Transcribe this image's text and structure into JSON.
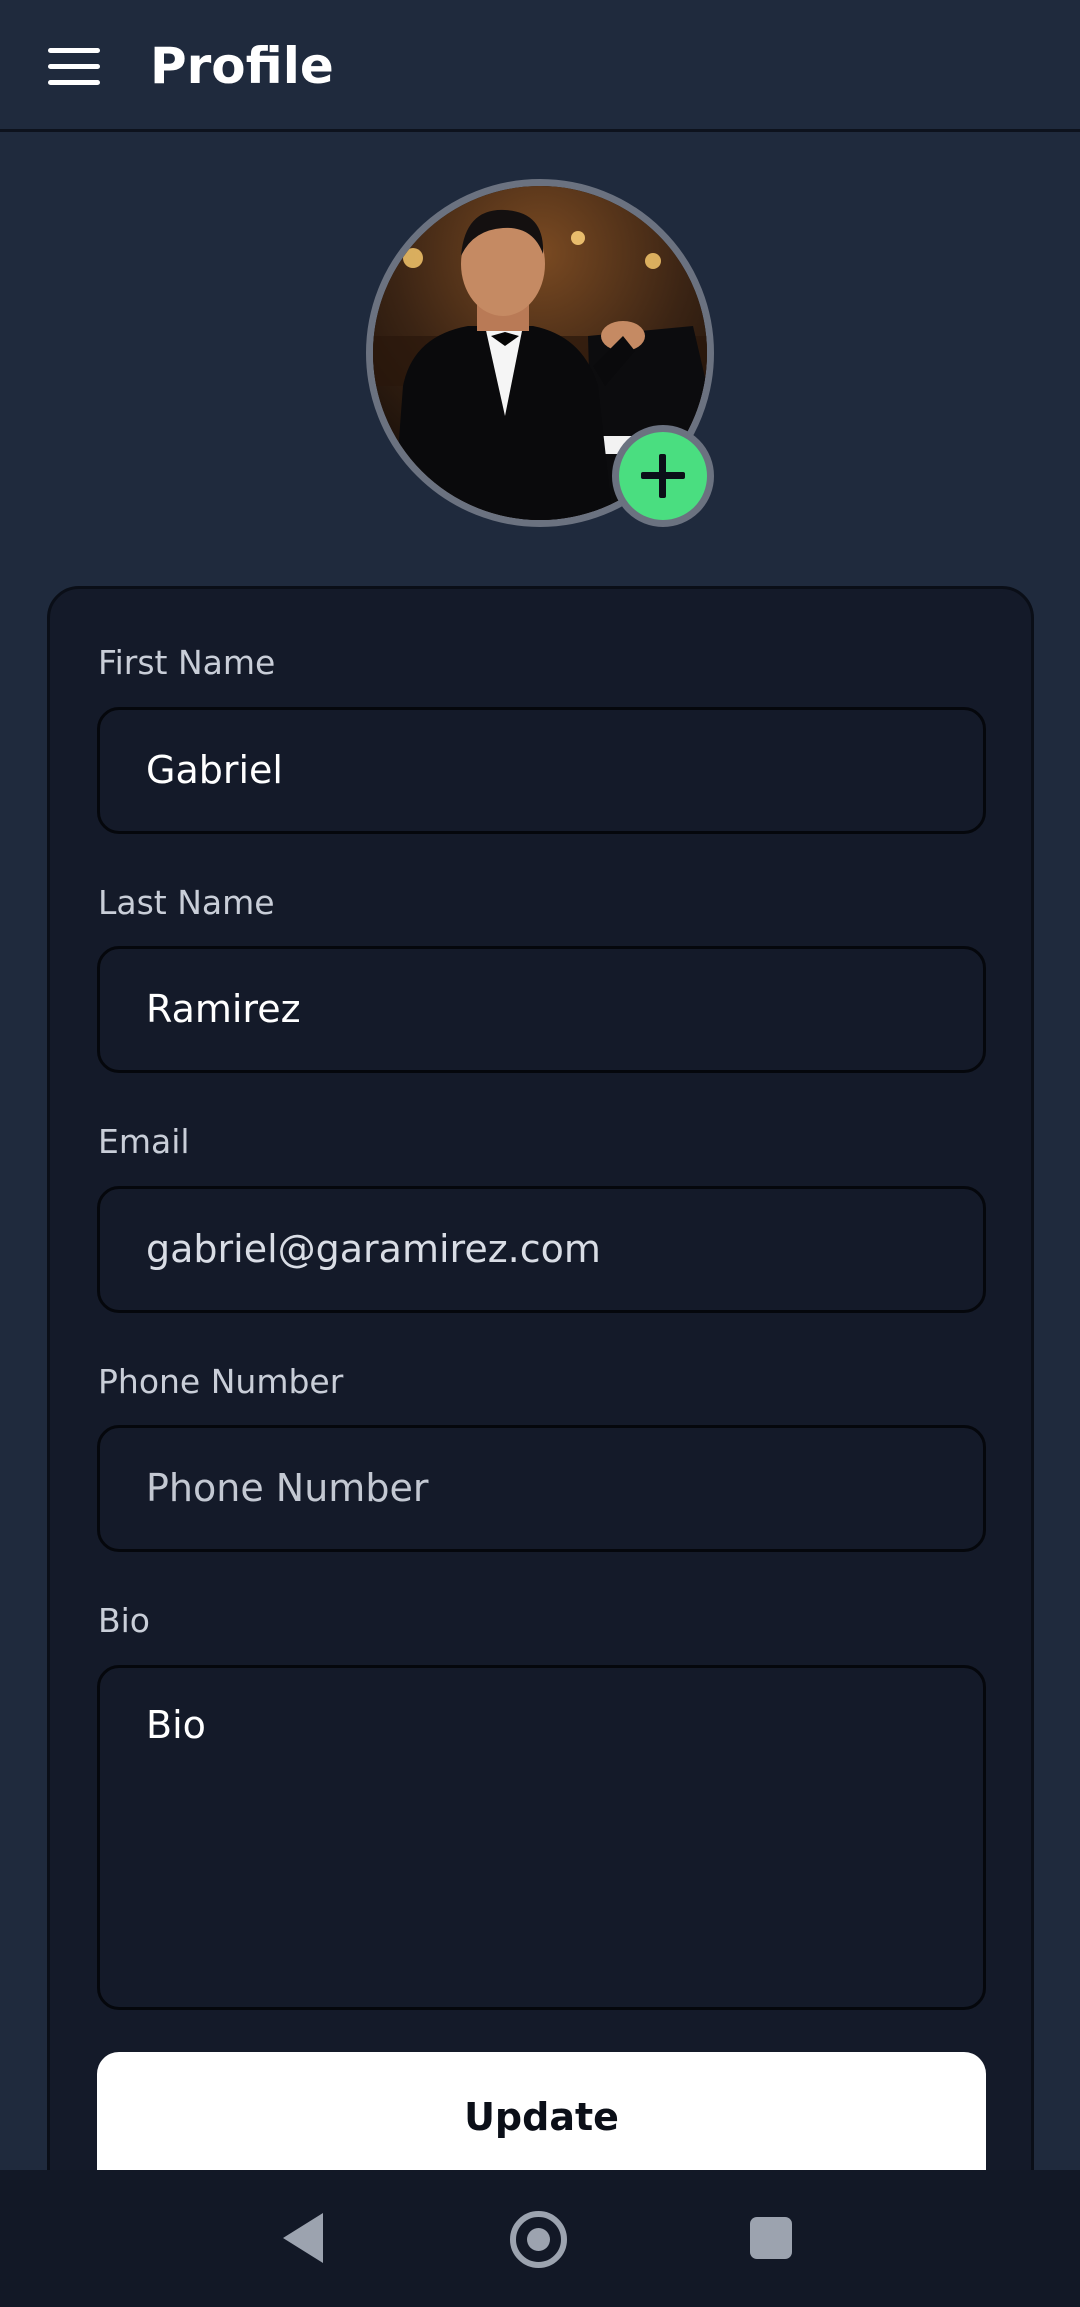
{
  "header": {
    "title": "Profile",
    "menu_icon": "hamburger-menu-icon"
  },
  "avatar": {
    "add_icon": "plus-icon",
    "accent_color": "#4ade80"
  },
  "form": {
    "first_name": {
      "label": "First Name",
      "value": "Gabriel"
    },
    "last_name": {
      "label": "Last Name",
      "value": "Ramirez"
    },
    "email": {
      "label": "Email",
      "value": "gabriel@garamirez.com"
    },
    "phone": {
      "label": "Phone Number",
      "value": "",
      "placeholder": "Phone Number"
    },
    "bio": {
      "label": "Bio",
      "value": "",
      "placeholder": "Bio"
    },
    "update_label": "Update"
  },
  "system_nav": {
    "back_icon": "back-triangle-icon",
    "home_icon": "home-circle-icon",
    "recents_icon": "recents-square-icon"
  }
}
